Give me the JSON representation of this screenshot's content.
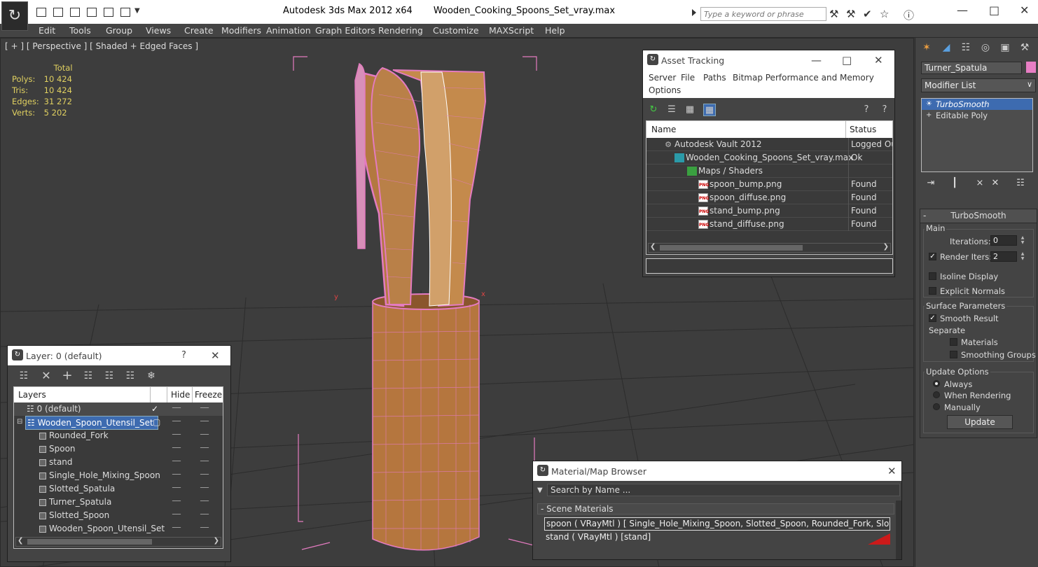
{
  "titlebar": {
    "app": "Autodesk 3ds Max  2012 x64",
    "file": "Wooden_Cooking_Spoons_Set_vray.max",
    "search_placeholder": "Type a keyword or phrase"
  },
  "menu": [
    "Edit",
    "Tools",
    "Group",
    "Views",
    "Create",
    "Modifiers",
    "Animation",
    "Graph Editors",
    "Rendering",
    "Customize",
    "MAXScript",
    "Help"
  ],
  "viewport": {
    "label": "[ + ] [ Perspective ] [ Shaded + Edged Faces ]",
    "stats": {
      "header": "Total",
      "labels": [
        "Polys:",
        "Tris:",
        "Edges:",
        "Verts:"
      ],
      "values": [
        "10 424",
        "10 424",
        "31 272",
        "5 202"
      ]
    },
    "axis_x": "x",
    "axis_y": "y"
  },
  "command_panel": {
    "object_name": "Turner_Spatula",
    "object_color": "#e87ec4",
    "modifier_list": "Modifier List",
    "stack": [
      "TurboSmooth",
      "Editable Poly"
    ],
    "rollout_title": "TurboSmooth",
    "main_group": "Main",
    "iterations_label": "Iterations:",
    "iterations_value": "0",
    "render_iters_label": "Render Iters:",
    "render_iters_value": "2",
    "isoline_label": "Isoline Display",
    "explicit_normals_label": "Explicit Normals",
    "surface_group": "Surface Parameters",
    "smooth_result_label": "Smooth Result",
    "separate_label": "Separate",
    "materials_label": "Materials",
    "smoothing_groups_label": "Smoothing Groups",
    "update_group": "Update Options",
    "always_label": "Always",
    "when_rendering_label": "When Rendering",
    "manually_label": "Manually",
    "update_button": "Update"
  },
  "asset_tracking": {
    "title": "Asset Tracking",
    "menus": [
      "Server",
      "File",
      "Paths",
      "Bitmap Performance and Memory",
      "Options"
    ],
    "col_name": "Name",
    "col_status": "Status",
    "rows": [
      {
        "name": "Autodesk Vault 2012",
        "status": "Logged Out",
        "icon": "vault"
      },
      {
        "name": "Wooden_Cooking_Spoons_Set_vray.max",
        "status": "Ok",
        "icon": "max"
      },
      {
        "name": "Maps / Shaders",
        "status": "",
        "icon": "maps"
      },
      {
        "name": "spoon_bump.png",
        "status": "Found",
        "icon": "png"
      },
      {
        "name": "spoon_diffuse.png",
        "status": "Found",
        "icon": "png"
      },
      {
        "name": "stand_bump.png",
        "status": "Found",
        "icon": "png"
      },
      {
        "name": "stand_diffuse.png",
        "status": "Found",
        "icon": "png"
      }
    ],
    "png_badge": "PNG"
  },
  "layer_dialog": {
    "title": "Layer: 0 (default)",
    "help": "?",
    "col_layers": "Layers",
    "col_hide": "Hide",
    "col_freeze": "Freeze",
    "rows": [
      {
        "name": "0 (default)",
        "kind": "layer"
      },
      {
        "name": "Wooden_Spoon_Utensil_Set",
        "kind": "layer-selected"
      },
      {
        "name": "Rounded_Fork",
        "kind": "object"
      },
      {
        "name": "Spoon",
        "kind": "object"
      },
      {
        "name": "stand",
        "kind": "object"
      },
      {
        "name": "Single_Hole_Mixing_Spoon",
        "kind": "object"
      },
      {
        "name": "Slotted_Spatula",
        "kind": "object"
      },
      {
        "name": "Turner_Spatula",
        "kind": "object"
      },
      {
        "name": "Slotted_Spoon",
        "kind": "object"
      },
      {
        "name": "Wooden_Spoon_Utensil_Set",
        "kind": "object"
      }
    ]
  },
  "material_browser": {
    "title": "Material/Map Browser",
    "search_placeholder": "Search by Name ...",
    "group": "- Scene Materials",
    "rows": [
      "spoon  ( VRayMtl ) [ Single_Hole_Mixing_Spoon, Slotted_Spoon, Rounded_Fork, Slotted_Spat...",
      "stand  ( VRayMtl ) [stand]"
    ]
  }
}
